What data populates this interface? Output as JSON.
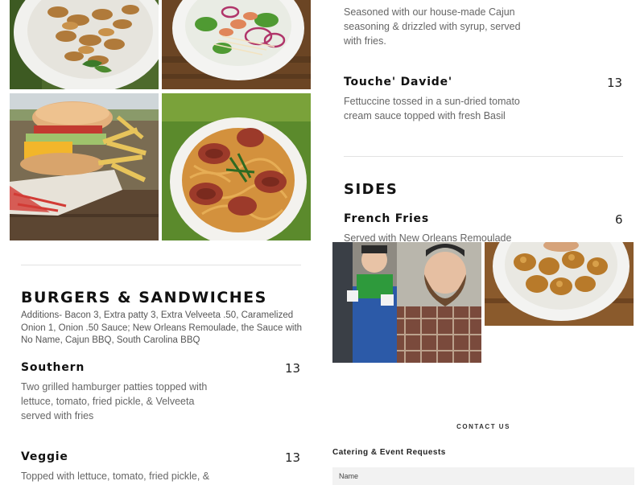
{
  "left_column": {
    "burgers_section": {
      "title": "BURGERS & SANDWICHES",
      "additions": "Additions- Bacon 3, Extra patty 3, Extra Velveeta .50, Caramelized Onion 1, Onion .50 Sauce; New Orleans Remoulade, the Sauce with No Name, Cajun BBQ, South Carolina BBQ",
      "items": [
        {
          "name": "Southern",
          "price": "13",
          "description": "Two grilled hamburger patties topped with lettuce, tomato, fried pickle, & Velveeta served with fries"
        },
        {
          "name": "Veggie",
          "price": "13",
          "description": "Topped with lettuce, tomato, fried pickle, &"
        }
      ]
    }
  },
  "right_column": {
    "entrees_partial": {
      "top_description": "Seasoned with our house-made Cajun seasoning & drizzled with syrup, served with fries.",
      "items": [
        {
          "name": "Touche' Davide'",
          "price": "13",
          "description": "Fettuccine tossed in a sun-dried tomato cream sauce topped with fresh Basil"
        }
      ]
    },
    "sides_section": {
      "title": "SIDES",
      "items": [
        {
          "name": "French Fries",
          "price": "6",
          "description": "Served with New Orleans Remoulade"
        }
      ]
    },
    "contact": {
      "label": "CONTACT US",
      "form_title": "Catering & Event Requests",
      "name_placeholder": "Name"
    }
  },
  "colors": {
    "heading": "#111111",
    "body_text": "#666666",
    "divider": "#e2e2e2",
    "field_bg": "#f2f2f2"
  }
}
